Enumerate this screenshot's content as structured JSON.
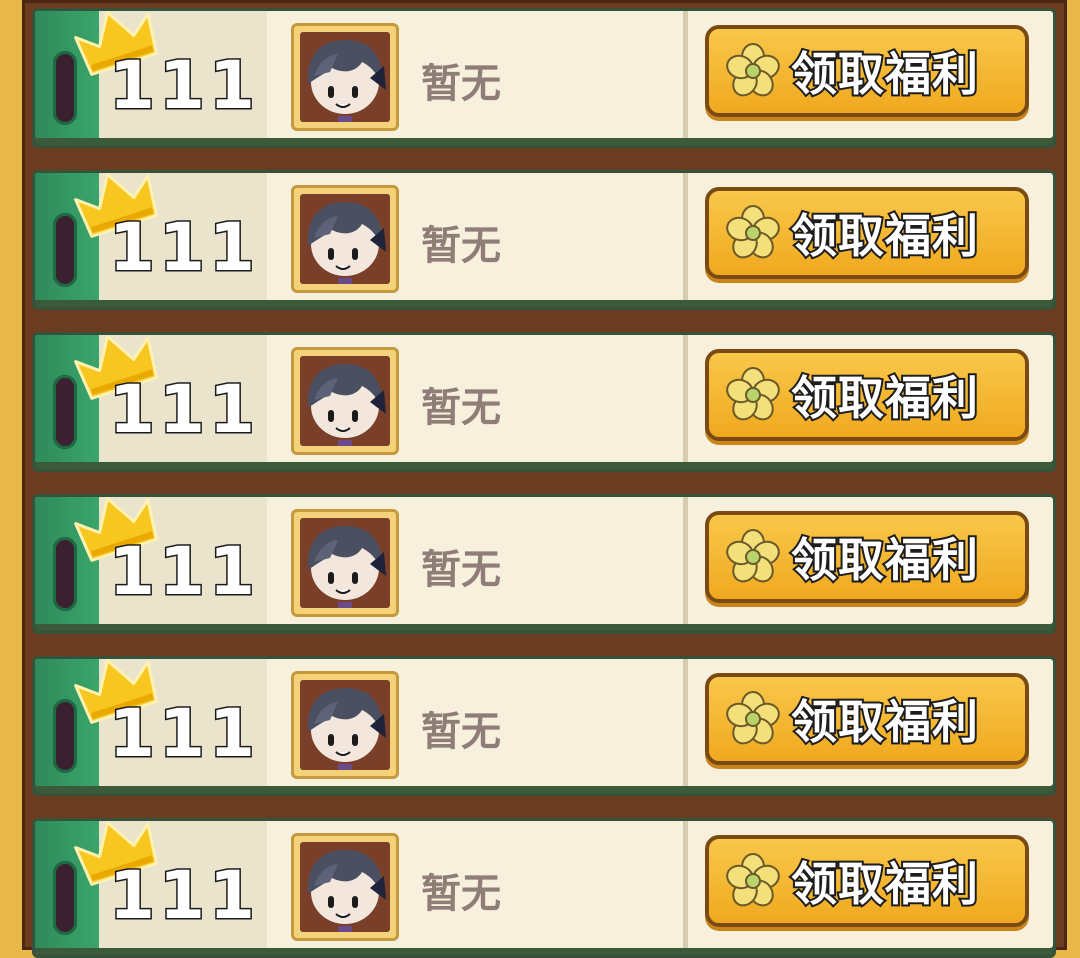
{
  "rows": [
    {
      "rank_digits": [
        "1",
        "1",
        "1"
      ],
      "name": "暂无",
      "button_label": "领取福利"
    },
    {
      "rank_digits": [
        "1",
        "1",
        "1"
      ],
      "name": "暂无",
      "button_label": "领取福利"
    },
    {
      "rank_digits": [
        "1",
        "1",
        "1"
      ],
      "name": "暂无",
      "button_label": "领取福利"
    },
    {
      "rank_digits": [
        "1",
        "1",
        "1"
      ],
      "name": "暂无",
      "button_label": "领取福利"
    },
    {
      "rank_digits": [
        "1",
        "1",
        "1"
      ],
      "name": "暂无",
      "button_label": "领取福利"
    },
    {
      "rank_digits": [
        "1",
        "1",
        "1"
      ],
      "name": "暂无",
      "button_label": "领取福利"
    }
  ],
  "icons": {
    "crown": "crown-icon",
    "flower": "flower-icon",
    "avatar": "avatar-portrait"
  },
  "colors": {
    "row_background": "#f7f0dd",
    "rank_bar": "#3aa56b",
    "button_fill": "#f9c74a",
    "board": "#6b3c1f",
    "name_text": "#8f7d77"
  }
}
